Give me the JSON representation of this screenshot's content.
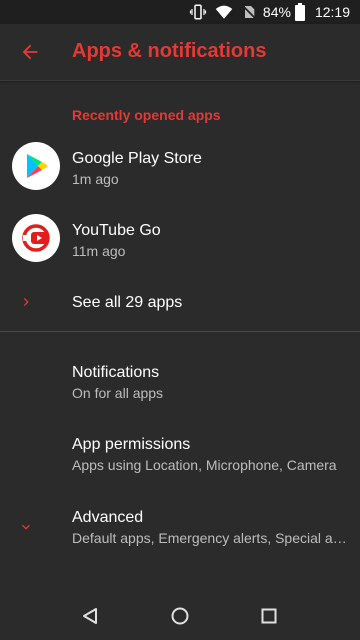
{
  "status_bar": {
    "battery_percent": "84%",
    "time": "12:19",
    "icons": [
      "vibrate-icon",
      "wifi-icon",
      "no-sim-icon",
      "battery-icon"
    ]
  },
  "app_bar": {
    "title": "Apps & notifications",
    "back_icon": "arrow-back-icon"
  },
  "recent_apps": {
    "header": "Recently opened apps",
    "items": [
      {
        "name": "Google Play Store",
        "time": "1m ago",
        "icon": "play-store-icon"
      },
      {
        "name": "YouTube Go",
        "time": "11m ago",
        "icon": "youtube-go-icon"
      }
    ],
    "see_all": "See all 29 apps"
  },
  "settings": [
    {
      "title": "Notifications",
      "subtitle": "On for all apps"
    },
    {
      "title": "App permissions",
      "subtitle": "Apps using Location, Microphone, Camera"
    },
    {
      "title": "Advanced",
      "subtitle": "Default apps, Emergency alerts, Special app access"
    }
  ],
  "nav_bar": {
    "buttons": [
      "back-triangle-icon",
      "home-circle-icon",
      "recents-square-icon"
    ]
  },
  "colors": {
    "accent": "#e53935",
    "background": "#2b2b2b",
    "text_primary": "#ffffff",
    "text_secondary": "#bdbdbd"
  }
}
